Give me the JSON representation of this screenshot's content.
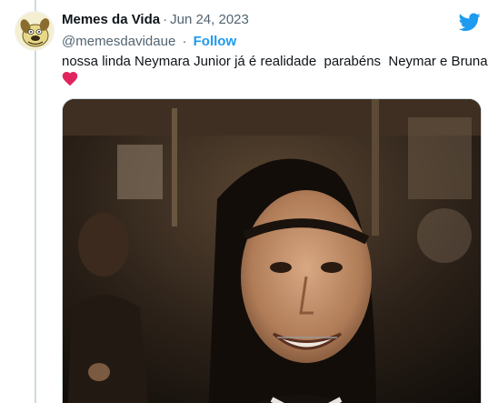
{
  "tweet": {
    "display_name": "Memes da Vida",
    "separator": "·",
    "date": "Jun 24, 2023",
    "handle": "@memesdavidaue",
    "follow_label": "Follow",
    "text": "nossa linda Neymara Junior já é realidade  parabéns  Neymar e Bruna",
    "emoji_icon": "red-heart-icon",
    "brand_icon": "twitter-bird-icon",
    "accent_color": "#1d9bf0",
    "heart_color": "#e0245e"
  },
  "media": {
    "description_icon": "photo"
  }
}
